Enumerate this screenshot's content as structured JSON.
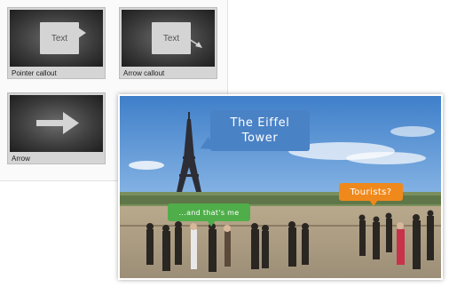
{
  "tiles": {
    "pointer_callout": {
      "label": "Pointer callout",
      "sample_text": "Text"
    },
    "arrow_callout": {
      "label": "Arrow callout",
      "sample_text": "Text"
    },
    "arrow": {
      "label": "Arrow"
    }
  },
  "photo": {
    "callouts": {
      "title_line1": "The Eiffel",
      "title_line2": "Tower",
      "tourists": "Tourists?",
      "thats_me": "...and that's me"
    }
  },
  "colors": {
    "blue_callout": "#4a82c6",
    "orange_callout": "#f0891c",
    "green_callout": "#4fae4a"
  }
}
